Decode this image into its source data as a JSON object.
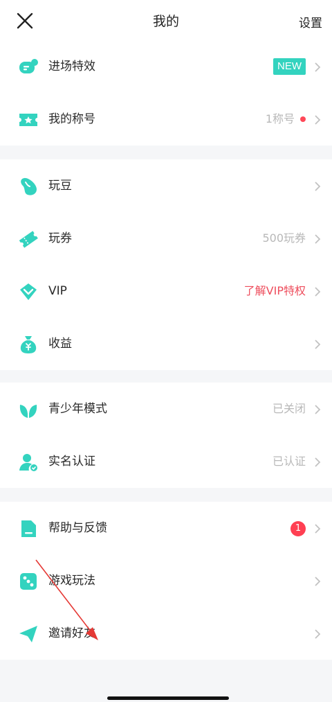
{
  "header": {
    "title": "我的",
    "settings_label": "设置"
  },
  "rows": {
    "entry_effects": {
      "label": "进场特效",
      "badge": "NEW"
    },
    "my_title": {
      "label": "我的称号",
      "value": "1称号"
    },
    "beans": {
      "label": "玩豆"
    },
    "coupons": {
      "label": "玩券",
      "value": "500玩券"
    },
    "vip": {
      "label": "VIP",
      "value": "了解VIP特权"
    },
    "earnings": {
      "label": "收益"
    },
    "teen_mode": {
      "label": "青少年模式",
      "value": "已关闭"
    },
    "real_name": {
      "label": "实名认证",
      "value": "已认证"
    },
    "help": {
      "label": "帮助与反馈",
      "badge": "1"
    },
    "gameplay": {
      "label": "游戏玩法"
    },
    "invite": {
      "label": "邀请好友"
    }
  },
  "colors": {
    "accent": "#33d3bf",
    "alert": "#ff3f52",
    "vip_text": "#ee4d5c",
    "section_bg": "#f5f6f8",
    "annotation_arrow": "#e53935"
  }
}
